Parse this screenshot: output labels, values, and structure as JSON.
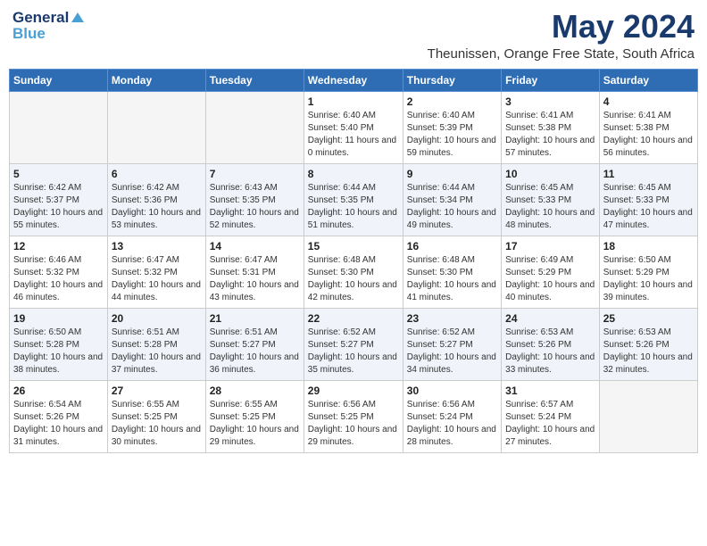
{
  "header": {
    "logo_general": "General",
    "logo_blue": "Blue",
    "month_title": "May 2024",
    "location": "Theunissen, Orange Free State, South Africa"
  },
  "days_of_week": [
    "Sunday",
    "Monday",
    "Tuesday",
    "Wednesday",
    "Thursday",
    "Friday",
    "Saturday"
  ],
  "weeks": [
    [
      {
        "day": "",
        "empty": true
      },
      {
        "day": "",
        "empty": true
      },
      {
        "day": "",
        "empty": true
      },
      {
        "day": "1",
        "sunrise": "6:40 AM",
        "sunset": "5:40 PM",
        "daylight": "11 hours and 0 minutes."
      },
      {
        "day": "2",
        "sunrise": "6:40 AM",
        "sunset": "5:39 PM",
        "daylight": "10 hours and 59 minutes."
      },
      {
        "day": "3",
        "sunrise": "6:41 AM",
        "sunset": "5:38 PM",
        "daylight": "10 hours and 57 minutes."
      },
      {
        "day": "4",
        "sunrise": "6:41 AM",
        "sunset": "5:38 PM",
        "daylight": "10 hours and 56 minutes."
      }
    ],
    [
      {
        "day": "5",
        "sunrise": "6:42 AM",
        "sunset": "5:37 PM",
        "daylight": "10 hours and 55 minutes."
      },
      {
        "day": "6",
        "sunrise": "6:42 AM",
        "sunset": "5:36 PM",
        "daylight": "10 hours and 53 minutes."
      },
      {
        "day": "7",
        "sunrise": "6:43 AM",
        "sunset": "5:35 PM",
        "daylight": "10 hours and 52 minutes."
      },
      {
        "day": "8",
        "sunrise": "6:44 AM",
        "sunset": "5:35 PM",
        "daylight": "10 hours and 51 minutes."
      },
      {
        "day": "9",
        "sunrise": "6:44 AM",
        "sunset": "5:34 PM",
        "daylight": "10 hours and 49 minutes."
      },
      {
        "day": "10",
        "sunrise": "6:45 AM",
        "sunset": "5:33 PM",
        "daylight": "10 hours and 48 minutes."
      },
      {
        "day": "11",
        "sunrise": "6:45 AM",
        "sunset": "5:33 PM",
        "daylight": "10 hours and 47 minutes."
      }
    ],
    [
      {
        "day": "12",
        "sunrise": "6:46 AM",
        "sunset": "5:32 PM",
        "daylight": "10 hours and 46 minutes."
      },
      {
        "day": "13",
        "sunrise": "6:47 AM",
        "sunset": "5:32 PM",
        "daylight": "10 hours and 44 minutes."
      },
      {
        "day": "14",
        "sunrise": "6:47 AM",
        "sunset": "5:31 PM",
        "daylight": "10 hours and 43 minutes."
      },
      {
        "day": "15",
        "sunrise": "6:48 AM",
        "sunset": "5:30 PM",
        "daylight": "10 hours and 42 minutes."
      },
      {
        "day": "16",
        "sunrise": "6:48 AM",
        "sunset": "5:30 PM",
        "daylight": "10 hours and 41 minutes."
      },
      {
        "day": "17",
        "sunrise": "6:49 AM",
        "sunset": "5:29 PM",
        "daylight": "10 hours and 40 minutes."
      },
      {
        "day": "18",
        "sunrise": "6:50 AM",
        "sunset": "5:29 PM",
        "daylight": "10 hours and 39 minutes."
      }
    ],
    [
      {
        "day": "19",
        "sunrise": "6:50 AM",
        "sunset": "5:28 PM",
        "daylight": "10 hours and 38 minutes."
      },
      {
        "day": "20",
        "sunrise": "6:51 AM",
        "sunset": "5:28 PM",
        "daylight": "10 hours and 37 minutes."
      },
      {
        "day": "21",
        "sunrise": "6:51 AM",
        "sunset": "5:27 PM",
        "daylight": "10 hours and 36 minutes."
      },
      {
        "day": "22",
        "sunrise": "6:52 AM",
        "sunset": "5:27 PM",
        "daylight": "10 hours and 35 minutes."
      },
      {
        "day": "23",
        "sunrise": "6:52 AM",
        "sunset": "5:27 PM",
        "daylight": "10 hours and 34 minutes."
      },
      {
        "day": "24",
        "sunrise": "6:53 AM",
        "sunset": "5:26 PM",
        "daylight": "10 hours and 33 minutes."
      },
      {
        "day": "25",
        "sunrise": "6:53 AM",
        "sunset": "5:26 PM",
        "daylight": "10 hours and 32 minutes."
      }
    ],
    [
      {
        "day": "26",
        "sunrise": "6:54 AM",
        "sunset": "5:26 PM",
        "daylight": "10 hours and 31 minutes."
      },
      {
        "day": "27",
        "sunrise": "6:55 AM",
        "sunset": "5:25 PM",
        "daylight": "10 hours and 30 minutes."
      },
      {
        "day": "28",
        "sunrise": "6:55 AM",
        "sunset": "5:25 PM",
        "daylight": "10 hours and 29 minutes."
      },
      {
        "day": "29",
        "sunrise": "6:56 AM",
        "sunset": "5:25 PM",
        "daylight": "10 hours and 29 minutes."
      },
      {
        "day": "30",
        "sunrise": "6:56 AM",
        "sunset": "5:24 PM",
        "daylight": "10 hours and 28 minutes."
      },
      {
        "day": "31",
        "sunrise": "6:57 AM",
        "sunset": "5:24 PM",
        "daylight": "10 hours and 27 minutes."
      },
      {
        "day": "",
        "empty": true
      }
    ]
  ]
}
